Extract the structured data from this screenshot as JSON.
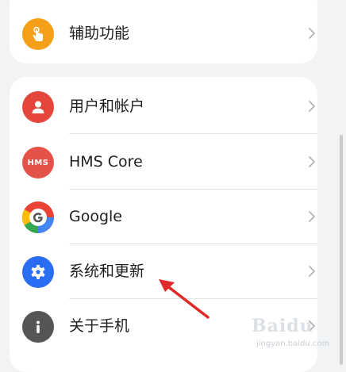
{
  "accessibility": {
    "label": "辅助功能",
    "icon": "hand-touch-icon",
    "color": "#f6a01a"
  },
  "settings": [
    {
      "key": "accounts",
      "label": "用户和帐户",
      "icon": "user-icon",
      "color": "#e5463b"
    },
    {
      "key": "hms",
      "label": "HMS Core",
      "icon": "hms-icon",
      "icon_text": "HMS",
      "color": "#e5524a"
    },
    {
      "key": "google",
      "label": "Google",
      "icon": "google-icon"
    },
    {
      "key": "system",
      "label": "系统和更新",
      "icon": "gear-icon",
      "color": "#2b6df2"
    },
    {
      "key": "about",
      "label": "关于手机",
      "icon": "info-icon",
      "color": "#555555"
    }
  ],
  "watermark": {
    "brand": "Baidu",
    "sub": "jingyan.baidu.com"
  },
  "colors": {
    "background": "#f1f3f5",
    "card": "#ffffff",
    "annotation": "#e02a2a"
  }
}
